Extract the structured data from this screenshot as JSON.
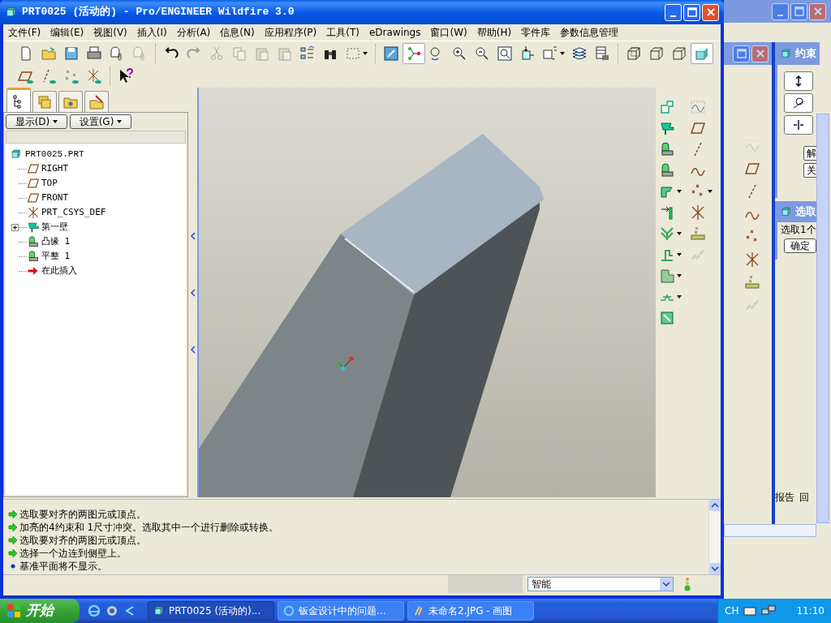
{
  "window": {
    "title": "PRT0025 (活动的) - Pro/ENGINEER Wildfire 3.0"
  },
  "menu": [
    "文件(F)",
    "编辑(E)",
    "视图(V)",
    "插入(I)",
    "分析(A)",
    "信息(N)",
    "应用程序(P)",
    "工具(T)",
    "eDrawings",
    "窗口(W)",
    "帮助(H)",
    "零件库",
    "参数信息管理"
  ],
  "main_toolbar": [
    {
      "disabled": false,
      "pressed": false
    },
    {
      "disabled": false,
      "pressed": false
    },
    {
      "disabled": false,
      "pressed": false
    },
    {
      "disabled": false,
      "pressed": false
    },
    {
      "disabled": false,
      "pressed": false
    },
    {
      "disabled": true,
      "pressed": false
    },
    {
      "disabled": false,
      "pressed": false
    },
    {
      "disabled": true,
      "pressed": false
    },
    {
      "disabled": true,
      "pressed": false
    },
    {
      "disabled": true,
      "pressed": false
    },
    {
      "disabled": true,
      "pressed": false
    },
    {
      "disabled": true,
      "pressed": false
    },
    {
      "disabled": false,
      "pressed": false
    },
    {
      "disabled": false,
      "pressed": false
    },
    {
      "disabled": false,
      "pressed": false
    },
    {
      "disabled": false,
      "pressed": false
    },
    {
      "disabled": false,
      "pressed": true
    },
    {
      "disabled": false,
      "pressed": false
    },
    {
      "disabled": false,
      "pressed": false
    },
    {
      "disabled": false,
      "pressed": false
    },
    {
      "disabled": false,
      "pressed": false
    },
    {
      "disabled": false,
      "pressed": false
    },
    {
      "disabled": false,
      "pressed": false
    },
    {
      "disabled": false,
      "pressed": false
    },
    {
      "disabled": false,
      "pressed": false
    },
    {
      "disabled": false,
      "pressed": false
    },
    {
      "disabled": false,
      "pressed": false
    },
    {
      "disabled": false,
      "pressed": false
    },
    {
      "disabled": false,
      "pressed": true
    }
  ],
  "datum_toolbar": [
    {
      "pressed": false
    },
    {
      "pressed": false
    },
    {
      "pressed": false
    },
    {
      "pressed": false
    },
    {
      "pressed": false
    }
  ],
  "model_tree": {
    "tabs": [
      {
        "selected": true
      },
      {
        "selected": false
      },
      {
        "selected": false
      },
      {
        "selected": false
      }
    ],
    "buttons": [
      "显示(D)",
      "设置(G)"
    ],
    "root": {
      "label": "PRT0025.PRT",
      "children": [
        {
          "kind": "plane",
          "label": "RIGHT"
        },
        {
          "kind": "plane",
          "label": "TOP"
        },
        {
          "kind": "plane",
          "label": "FRONT"
        },
        {
          "kind": "csys",
          "label": "PRT_CSYS_DEF"
        },
        {
          "kind": "wall",
          "label": "第一壁",
          "expanded": false
        },
        {
          "kind": "flange",
          "label": "凸缘 1"
        },
        {
          "kind": "flatten",
          "label": "平整 1"
        },
        {
          "kind": "insert",
          "label": "在此插入"
        }
      ]
    }
  },
  "feature_toolbar": [
    {
      "disabled": false
    },
    {
      "disabled": false
    },
    {
      "disabled": false
    },
    {
      "disabled": false
    },
    {
      "disabled": false
    },
    {
      "disabled": false
    },
    {
      "disabled": false
    },
    {
      "disabled": false
    },
    {
      "disabled": false
    },
    {
      "disabled": false
    },
    {
      "disabled": false
    },
    {
      "disabled": false
    },
    {
      "disabled": false
    },
    {
      "disabled": false
    },
    {
      "disabled": false
    },
    {
      "disabled": false
    },
    {
      "disabled": false
    },
    {
      "disabled": false
    },
    {
      "disabled": true
    }
  ],
  "messages": [
    {
      "kind": "prompt",
      "text": "选取要对齐的两图元或顶点。"
    },
    {
      "kind": "prompt",
      "text": "加亮的4约束和 1尺寸冲突。选取其中一个进行删除或转换。"
    },
    {
      "kind": "prompt",
      "text": "选取要对齐的两图元或顶点。"
    },
    {
      "kind": "prompt",
      "text": "选择一个边连到侧壁上。"
    },
    {
      "kind": "info",
      "text": "基准平面将不显示。"
    }
  ],
  "status_bar": {
    "filter": "智能"
  },
  "background_windows": {
    "constraints_title": "约束",
    "constraints_buttons": [
      "解",
      "关"
    ],
    "select_title": "选取",
    "select_prompt": "选取1个",
    "select_ok": "确定",
    "footer": [
      "报告",
      "回"
    ]
  },
  "taskbar": {
    "start": "开始",
    "tasks": [
      {
        "label": "PRT0025 (活动的)...",
        "selected": true
      },
      {
        "label": "钣金设计中的问题...",
        "selected": false
      },
      {
        "label": "未命名2.JPG - 画图",
        "selected": false
      }
    ],
    "language": "CH",
    "clock": "11:10"
  }
}
